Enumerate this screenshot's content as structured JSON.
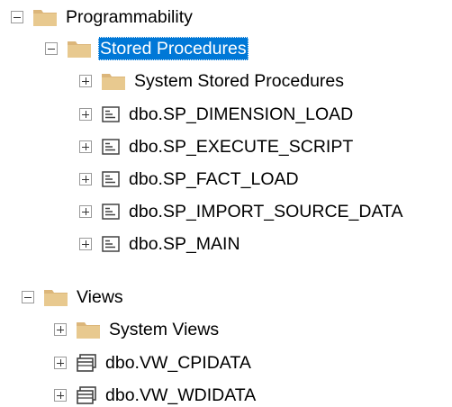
{
  "tree": {
    "nodes": [
      {
        "key": "programmability",
        "label": "Programmability",
        "expander": "minus",
        "icon": "folder-icon",
        "selected": false
      },
      {
        "key": "stored-procedures",
        "label": "Stored Procedures",
        "expander": "minus",
        "icon": "folder-icon",
        "selected": true
      },
      {
        "key": "system-stored-procedures",
        "label": "System Stored Procedures",
        "expander": "plus",
        "icon": "folder-icon",
        "selected": false
      },
      {
        "key": "sp-dimension-load",
        "label": "dbo.SP_DIMENSION_LOAD",
        "expander": "plus",
        "icon": "stored-procedure-icon",
        "selected": false
      },
      {
        "key": "sp-execute-script",
        "label": "dbo.SP_EXECUTE_SCRIPT",
        "expander": "plus",
        "icon": "stored-procedure-icon",
        "selected": false
      },
      {
        "key": "sp-fact-load",
        "label": "dbo.SP_FACT_LOAD",
        "expander": "plus",
        "icon": "stored-procedure-icon",
        "selected": false
      },
      {
        "key": "sp-import-source-data",
        "label": "dbo.SP_IMPORT_SOURCE_DATA",
        "expander": "plus",
        "icon": "stored-procedure-icon",
        "selected": false
      },
      {
        "key": "sp-main",
        "label": "dbo.SP_MAIN",
        "expander": "plus",
        "icon": "stored-procedure-icon",
        "selected": false
      },
      {
        "key": "views",
        "label": "Views",
        "expander": "minus",
        "icon": "folder-icon",
        "selected": false
      },
      {
        "key": "system-views",
        "label": "System Views",
        "expander": "plus",
        "icon": "folder-icon",
        "selected": false
      },
      {
        "key": "vw-cpidata",
        "label": "dbo.VW_CPIDATA",
        "expander": "plus",
        "icon": "view-icon",
        "selected": false
      },
      {
        "key": "vw-wdidata",
        "label": "dbo.VW_WDIDATA",
        "expander": "plus",
        "icon": "view-icon",
        "selected": false
      }
    ]
  },
  "colors": {
    "selection": "#0078d7",
    "folder": "#dcb67a",
    "folder_dark": "#c9a15b",
    "expander_border": "#9a9a9a",
    "icon_stroke": "#424242"
  }
}
